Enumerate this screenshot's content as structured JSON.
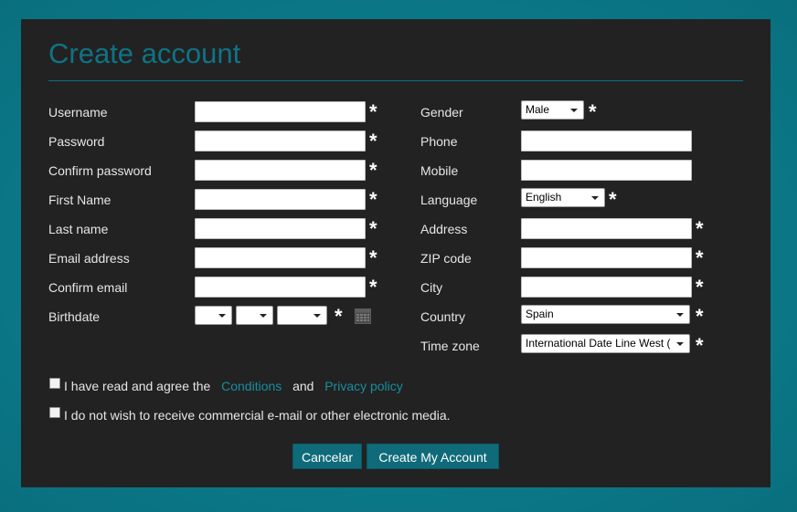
{
  "page": {
    "title": "Create account"
  },
  "left_fields": [
    {
      "label": "Username",
      "required": "*"
    },
    {
      "label": "Password",
      "required": "*"
    },
    {
      "label": "Confirm password",
      "required": "*"
    },
    {
      "label": "First Name",
      "required": "*"
    },
    {
      "label": "Last name",
      "required": "*"
    },
    {
      "label": "Email address",
      "required": "*"
    },
    {
      "label": "Confirm email",
      "required": "*"
    }
  ],
  "birthdate": {
    "label": "Birthdate",
    "day": "",
    "month": "",
    "year": "",
    "required": "*",
    "icon": "calendar-icon"
  },
  "right_fields": {
    "gender": {
      "label": "Gender",
      "value": "Male",
      "required": "*"
    },
    "phone": {
      "label": "Phone"
    },
    "mobile": {
      "label": "Mobile"
    },
    "language": {
      "label": "Language",
      "value": "English",
      "required": "*"
    },
    "address": {
      "label": "Address",
      "required": "*"
    },
    "zip": {
      "label": "ZIP code",
      "required": "*"
    },
    "city": {
      "label": "City",
      "required": "*"
    },
    "country": {
      "label": "Country",
      "value": "Spain",
      "required": "*"
    },
    "timezone": {
      "label": "Time zone",
      "value": "International Date Line West (",
      "required": "*"
    }
  },
  "agreements": {
    "terms_prefix": "I have read and agree the",
    "conditions_link": "Conditions",
    "and_text": "and",
    "privacy_link": "Privacy policy",
    "no_commercial": "I do not wish to receive commercial e-mail or other electronic media."
  },
  "buttons": {
    "cancel": "Cancelar",
    "create": "Create My Account"
  },
  "colors": {
    "background": "#0b7a8a",
    "panel": "#222222",
    "accent": "#0f7385",
    "link": "#178ea0",
    "button": "#0f6b7a"
  }
}
